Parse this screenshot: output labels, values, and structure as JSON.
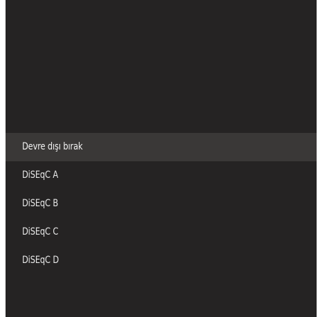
{
  "menu": {
    "items": [
      {
        "label": "Devre dışı bırak"
      },
      {
        "label": "DiSEqC A"
      },
      {
        "label": "DiSEqC B"
      },
      {
        "label": "DiSEqC C"
      },
      {
        "label": "DiSEqC D"
      }
    ],
    "selected_index": 0
  },
  "colors": {
    "panel_background": "#252323",
    "selected_background": "#3a3837",
    "text": "#e6e6e6",
    "outer_background": "#ffffff"
  }
}
